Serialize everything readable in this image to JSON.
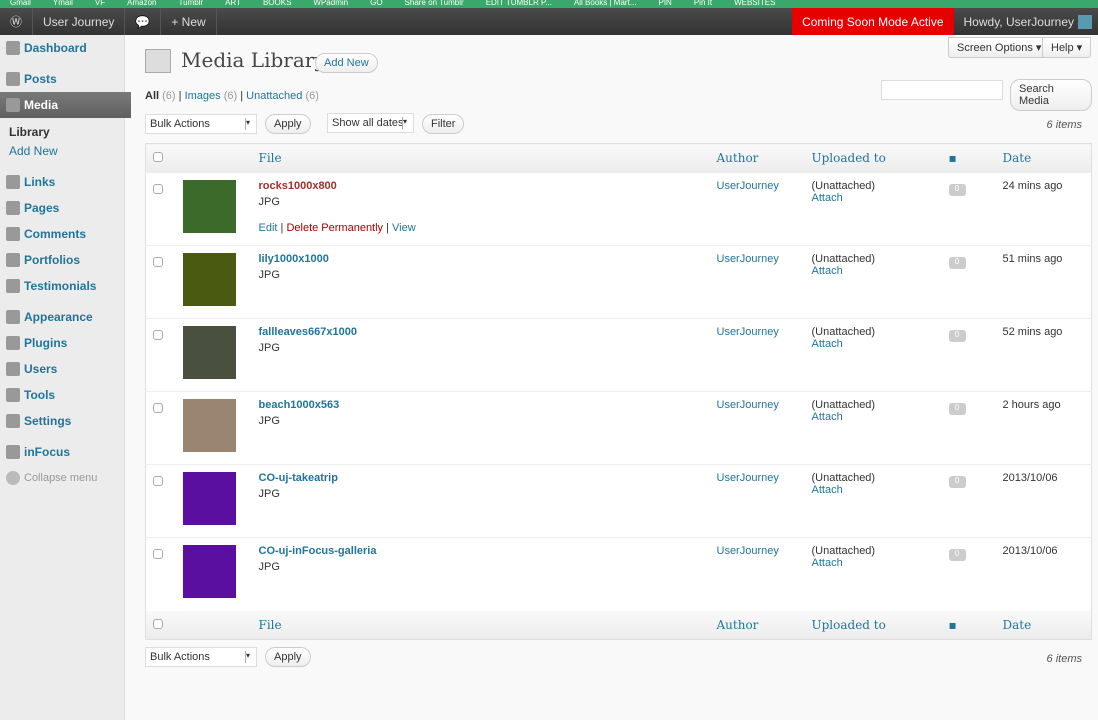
{
  "bookmarks": [
    "Gmail",
    "Ymail",
    "VF",
    "Amazon",
    "Tumblr",
    "ART",
    "BOOKS",
    "WPadmin",
    "GO",
    "Share on Tumblr",
    "EDIT TUMBLR P...",
    "All Books | Mart...",
    "PIN",
    "Pin It",
    "WEBSITES"
  ],
  "adminbar": {
    "site": "User Journey",
    "new": "+ New",
    "coming": "Coming Soon Mode Active",
    "howdy": "Howdy, UserJourney"
  },
  "sidebar": {
    "items": [
      "Dashboard",
      "Posts",
      "Media",
      "Links",
      "Pages",
      "Comments",
      "Portfolios",
      "Testimonials",
      "Appearance",
      "Plugins",
      "Users",
      "Tools",
      "Settings",
      "inFocus",
      "Collapse menu"
    ],
    "sub": [
      "Library",
      "Add New"
    ]
  },
  "header": {
    "title": "Media Library",
    "add_new": "Add New",
    "screen_options": "Screen Options ▾",
    "help": "Help ▾"
  },
  "filters": {
    "all": "All",
    "all_count": "(6)",
    "images": "Images",
    "images_count": "(6)",
    "unattached": "Unattached",
    "unattached_count": "(6)"
  },
  "search": {
    "button": "Search Media",
    "value": ""
  },
  "toolbar": {
    "bulk": "Bulk Actions",
    "apply": "Apply",
    "dates": "Show all dates",
    "filter": "Filter",
    "count": "6 items"
  },
  "columns": {
    "file": "File",
    "author": "Author",
    "uploaded": "Uploaded to",
    "date": "Date"
  },
  "row_actions": {
    "edit": "Edit",
    "delete": "Delete Permanently",
    "view": "View"
  },
  "rows": [
    {
      "name": "rocks1000x800",
      "type": "JPG",
      "author": "UserJourney",
      "uploaded": "(Unattached)",
      "attach": "Attach",
      "comments": "0",
      "date": "24 mins ago",
      "color": "#3c6a2a"
    },
    {
      "name": "lily1000x1000",
      "type": "JPG",
      "author": "UserJourney",
      "uploaded": "(Unattached)",
      "attach": "Attach",
      "comments": "0",
      "date": "51 mins ago",
      "color": "#4a5a10"
    },
    {
      "name": "fallleaves667x1000",
      "type": "JPG",
      "author": "UserJourney",
      "uploaded": "(Unattached)",
      "attach": "Attach",
      "comments": "0",
      "date": "52 mins ago",
      "color": "#4a5040"
    },
    {
      "name": "beach1000x563",
      "type": "JPG",
      "author": "UserJourney",
      "uploaded": "(Unattached)",
      "attach": "Attach",
      "comments": "0",
      "date": "2 hours ago",
      "color": "#9a8570"
    },
    {
      "name": "CO-uj-takeatrip",
      "type": "JPG",
      "author": "UserJourney",
      "uploaded": "(Unattached)",
      "attach": "Attach",
      "comments": "0",
      "date": "2013/10/06",
      "color": "#5a0fa0"
    },
    {
      "name": "CO-uj-inFocus-galleria",
      "type": "JPG",
      "author": "UserJourney",
      "uploaded": "(Unattached)",
      "attach": "Attach",
      "comments": "0",
      "date": "2013/10/06",
      "color": "#5a0fa0"
    }
  ]
}
